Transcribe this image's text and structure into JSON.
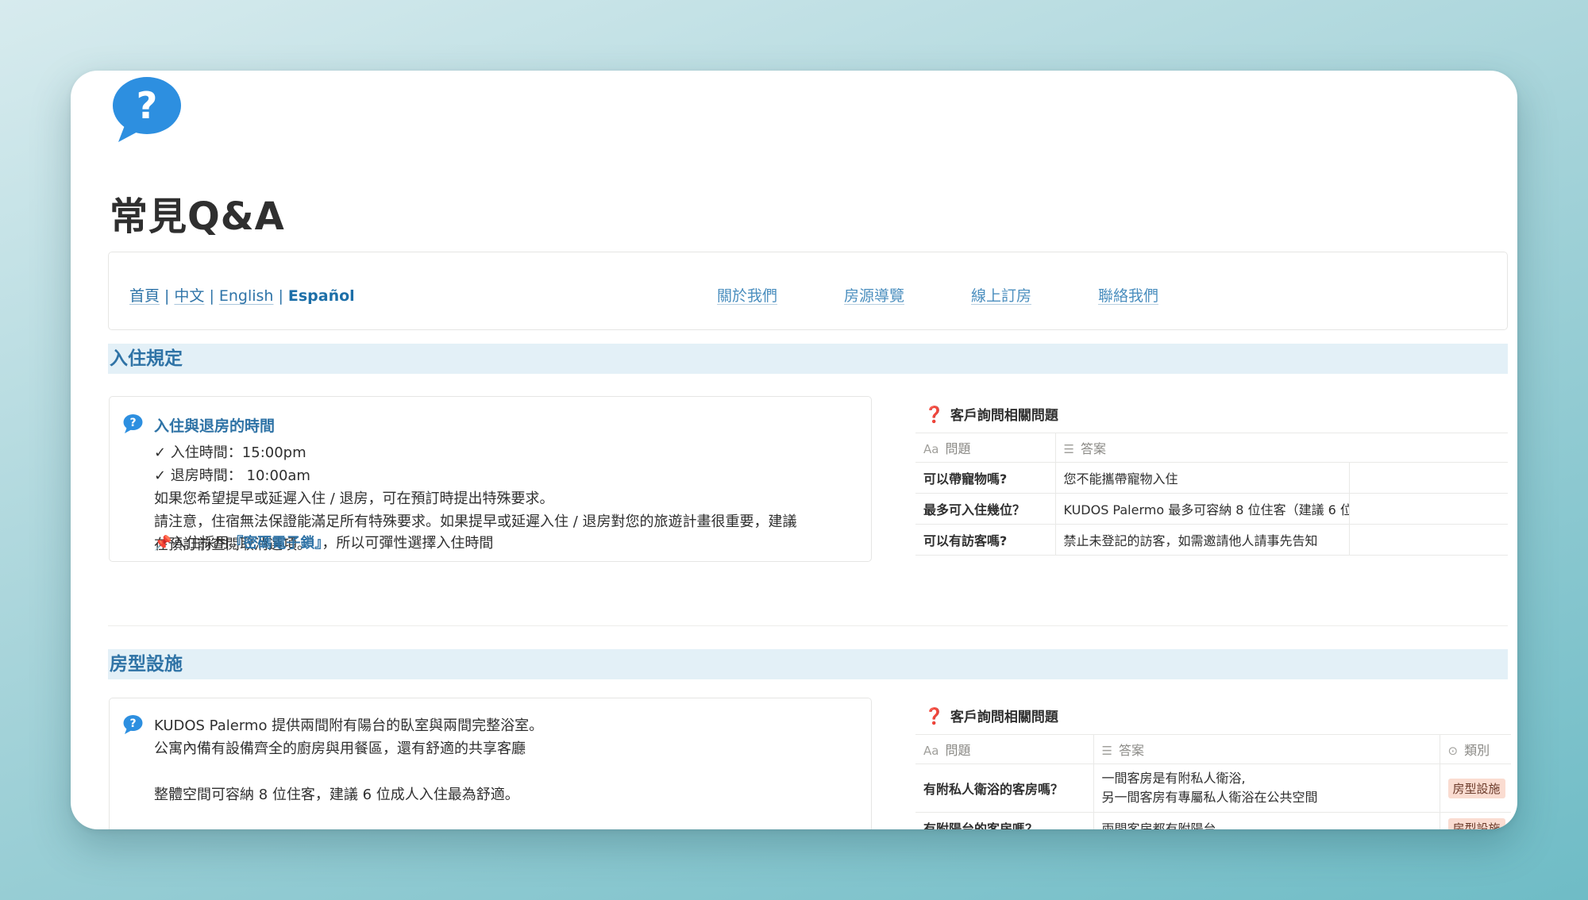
{
  "page": {
    "title": "常見Q&A",
    "icon": "speech-bubble-question-icon"
  },
  "nav": {
    "lang": [
      "首頁",
      "中文",
      "English",
      "Español"
    ],
    "sep": "|",
    "links": [
      "關於我們",
      "房源導覽",
      "線上訂房",
      "聯絡我們"
    ]
  },
  "sections": [
    {
      "heading": "入住規定",
      "card": {
        "title": "入住與退房的時間",
        "body": "✓ 入住時間：15:00pm\n✓ 退房時間： 10:00am\n如果您希望提早或延遲入住 / 退房，可在預訂時提出特殊要求。\n請注意，住宿無法保證能滿足所有特殊要求。如果提早或延遲入住 / 退房對您的旅遊計畫很重要，建議\n在預訂前查閱取消選項。",
        "note_pin": "📌",
        "note_pre": "入住採用",
        "note_link": "『密碼電子鎖』",
        "note_post": "，所以可彈性選擇入住時間"
      },
      "db": {
        "title": "客戶詢問相關問題",
        "col_question": "問題",
        "col_answer": "答案",
        "rows": [
          {
            "q": "可以帶寵物嗎?",
            "a": "您不能攜帶寵物入住"
          },
          {
            "q": "最多可入住幾位？",
            "a": "KUDOS Palermo 最多可容納 8 位住客（建議 6 位"
          },
          {
            "q": "可以有訪客嗎?",
            "a": "禁止未登記的訪客，如需邀請他人請事先告知"
          }
        ]
      }
    },
    {
      "heading": "房型設施",
      "card": {
        "body": "KUDOS Palermo 提供兩間附有陽台的臥室與兩間完整浴室。\n公寓內備有設備齊全的廚房與用餐區，還有舒適的共享客廳\n\n整體空間可容納 8 位住客，建議 6 位成人入住最為舒適。"
      },
      "db": {
        "title": "客戶詢問相關問題",
        "col_question": "問題",
        "col_answer": "答案",
        "col_category": "類別",
        "rows": [
          {
            "q": "有附私人衛浴的客房嗎？",
            "a": "一間客房是有附私人衛浴,\n另一間客房有專屬私人衛浴在公共空間",
            "tag": "房型設施"
          },
          {
            "q": "有附陽台的客房嗎？",
            "a": "兩間客房都有附陽台",
            "tag": "房型設施"
          }
        ]
      }
    }
  ],
  "colors": {
    "accent": "#2f73a6",
    "section_bg": "#e3f0f7",
    "tag_bg": "#fadcd1"
  }
}
